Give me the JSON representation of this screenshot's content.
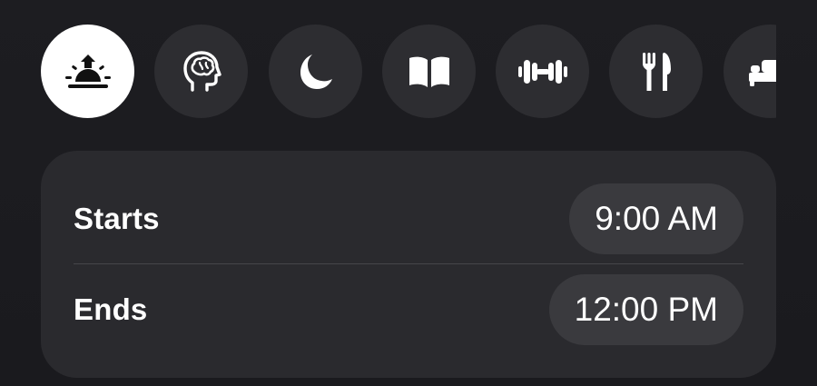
{
  "focus_icons": [
    {
      "name": "sunrise-alarm-icon",
      "selected": true
    },
    {
      "name": "brain-head-icon",
      "selected": false
    },
    {
      "name": "moon-icon",
      "selected": false
    },
    {
      "name": "book-icon",
      "selected": false
    },
    {
      "name": "dumbbell-icon",
      "selected": false
    },
    {
      "name": "fork-knife-icon",
      "selected": false
    },
    {
      "name": "bed-icon",
      "selected": false
    }
  ],
  "schedule": {
    "starts_label": "Starts",
    "starts_value": "9:00 AM",
    "ends_label": "Ends",
    "ends_value": "12:00 PM"
  },
  "colors": {
    "background": "#1d1d21",
    "icon_button": "#2d2d31",
    "selected_button": "#ffffff",
    "card": "#2a2a2e",
    "time_pill": "#3a3a3e",
    "text": "#ffffff"
  }
}
